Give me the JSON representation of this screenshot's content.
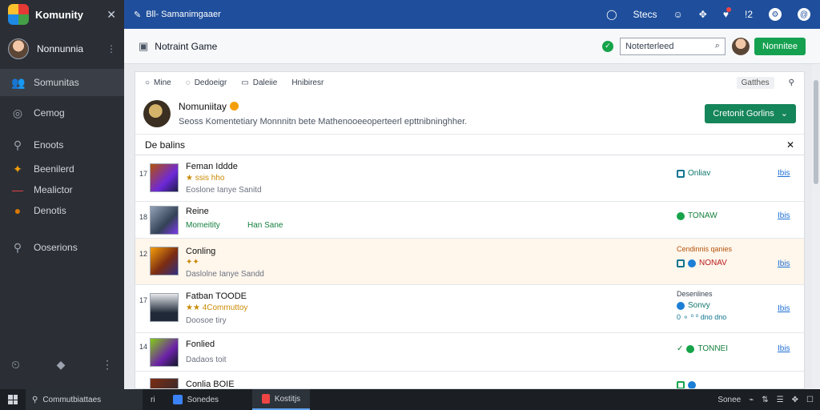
{
  "sidebar": {
    "app_title": "Komunity",
    "close": "✕",
    "username": "Nonnunnia",
    "more": "⋮",
    "items": [
      {
        "label": "Somunitas",
        "icon": "users-icon",
        "glyph": "👥"
      },
      {
        "label": "Cemog",
        "icon": "gamepad-icon",
        "glyph": "◎"
      },
      {
        "label": "Enoots",
        "icon": "search-icon",
        "glyph": "⚲"
      },
      {
        "label": "Beenilerd",
        "icon": "wand-icon",
        "glyph": "✦"
      },
      {
        "label": "Mealictor",
        "icon": "minus-icon",
        "glyph": "—"
      },
      {
        "label": "Denotis",
        "icon": "cookie-icon",
        "glyph": "●"
      },
      {
        "label": "Ooserions",
        "icon": "search-icon",
        "glyph": "⚲"
      }
    ],
    "bottom_left": "⏲",
    "bottom_right": "◆"
  },
  "topbar": {
    "title": "Bll- Samanimgaaer",
    "title_icon": "✎",
    "link": "Stecs",
    "icons": [
      "◯",
      "☺",
      "✥",
      "♥",
      "!2",
      "⚙",
      "@"
    ]
  },
  "subheader": {
    "title": "Notraint Game",
    "input_value": "Noterterleed",
    "input_icon": "⌕",
    "button": "Nonnitee"
  },
  "filters": [
    {
      "label": "Mine",
      "icon": "○"
    },
    {
      "label": "Dedoeigr",
      "icon": "◌"
    },
    {
      "label": "Daleiie",
      "icon": "▭"
    },
    {
      "label": "Hnibiresr",
      "icon": ""
    }
  ],
  "filter_button": "Gatthes",
  "hero": {
    "title": "Nomuniitay",
    "description": "Seoss Komentetiary Monnnitn bete Mathenooeeoperteerl epttnibninghher.",
    "button": "Cretonit Gorlins"
  },
  "section": {
    "title": "De balins",
    "close": "✕"
  },
  "rows": [
    {
      "num": "17",
      "name": "Feman Iddde",
      "sub": "★ ssis   hho",
      "sub2": "Eoslone Ianye   Sanitd",
      "status_text": "Onliav",
      "link": "Ibis"
    },
    {
      "num": "18",
      "name": "Reine",
      "sub": "Momeitity",
      "extra": "Han Sane",
      "status_text": "TONAW",
      "link": "Ibis"
    },
    {
      "num": "12",
      "name": "Conling",
      "sub": "✦✦",
      "sub2": "Daslolne Ianye   Sandd",
      "status_label": "Cendinnis qanies",
      "status_text": "NONAV",
      "link": "Ibis"
    },
    {
      "num": "17",
      "name": "Fatban TOODE",
      "sub": "★★ 4Commuttoy",
      "sub2": "Doosoe tiry",
      "status_label": "Desenlines",
      "status_text": "Sonvy",
      "status_small": "0 ⚬ ⁰ ⁰ dno dno",
      "link": "Ibis"
    },
    {
      "num": "14",
      "name": "Fonlied",
      "sub2": "Dadaos toit",
      "status_text": "TONNEI",
      "link": "Ibis"
    },
    {
      "num": "",
      "name": "Conlia BOIE",
      "status_text": "",
      "link": ""
    }
  ],
  "taskbar": {
    "search": "Commutbiattaes",
    "apps": [
      {
        "label": "Sonedes",
        "color": "#3b82f6"
      },
      {
        "label": "Kostitjs",
        "color": "#ef4444"
      }
    ],
    "mid": "ri",
    "right_text": "Sonee",
    "right_icons": [
      "⌁",
      "⇅",
      "☰",
      "✥",
      "☐"
    ]
  },
  "colors": {
    "topbar": "#1f4f9c",
    "sidebar": "#2b2f35",
    "accent_green": "#15a150",
    "link_blue": "#1e6fd6"
  }
}
